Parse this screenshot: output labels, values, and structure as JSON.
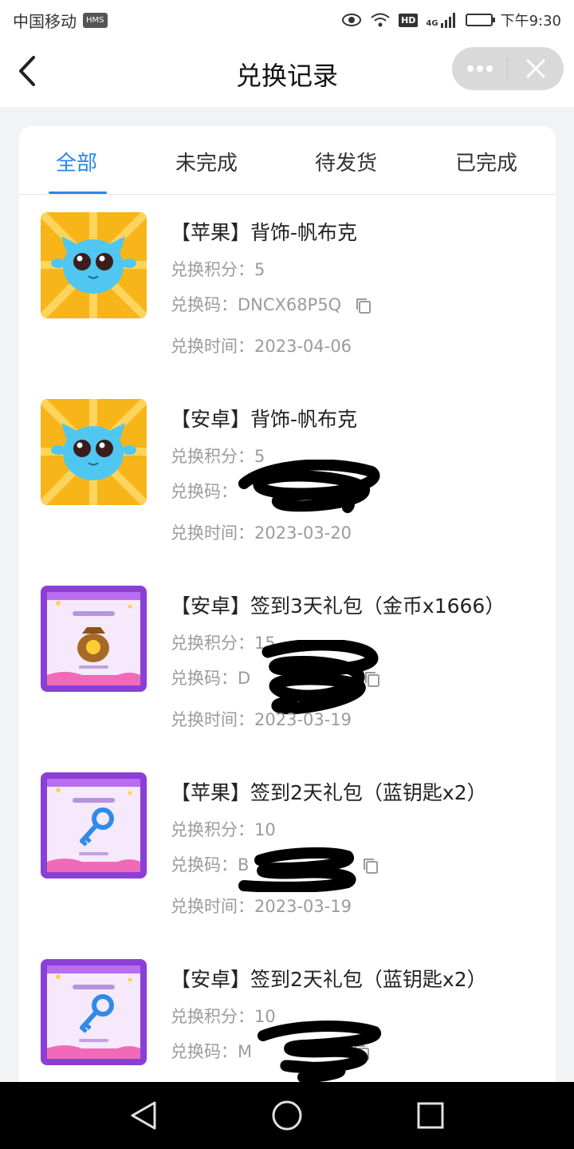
{
  "status_bar": {
    "carrier": "中国移动",
    "hms_badge": "HMS",
    "hd_badge": "HD",
    "network": "4G",
    "time": "下午9:30",
    "icons": [
      "eye-icon",
      "wifi-icon",
      "signal-icon",
      "battery-charging-icon"
    ]
  },
  "nav": {
    "title": "兑换记录",
    "back_icon": "chevron-left-icon",
    "more_icon": "more-icon",
    "close_icon": "close-icon"
  },
  "tabs": [
    {
      "label": "全部",
      "active": true
    },
    {
      "label": "未完成",
      "active": false
    },
    {
      "label": "待发货",
      "active": false
    },
    {
      "label": "已完成",
      "active": false
    }
  ],
  "labels": {
    "points": "兑换积分：",
    "code": "兑换码：",
    "time": "兑换时间："
  },
  "items": [
    {
      "title": "【苹果】背饰-帆布克",
      "points": "5",
      "code": "DNCX68P5Q",
      "time": "2023-04-06",
      "image": "blue-creature-avatar"
    },
    {
      "title": "【安卓】背饰-帆布克",
      "points": "5",
      "code": "",
      "time": "2023-03-20",
      "image": "blue-creature-avatar"
    },
    {
      "title": "【安卓】签到3天礼包（金币x1666）",
      "points": "15",
      "code": "D",
      "time": "2023-03-19",
      "image": "gold-coin-bag-giftpack"
    },
    {
      "title": "【苹果】签到2天礼包（蓝钥匙x2）",
      "points": "10",
      "code": "B",
      "time": "2023-03-19",
      "image": "blue-key-giftpack"
    },
    {
      "title": "【安卓】签到2天礼包（蓝钥匙x2）",
      "points": "10",
      "code": "M",
      "time": "",
      "image": "blue-key-giftpack"
    }
  ],
  "colors": {
    "accent": "#2a86e8",
    "meta_text": "#9b9b9b",
    "background": "#f2f3f5"
  },
  "system_nav": [
    "back-triangle-icon",
    "home-circle-icon",
    "recents-square-icon"
  ]
}
